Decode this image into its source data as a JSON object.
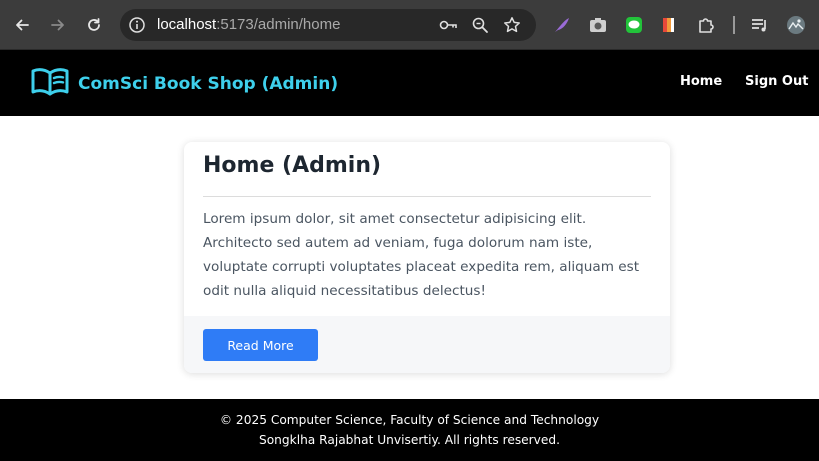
{
  "browser": {
    "url_host": "localhost",
    "url_path": ":5173/admin/home",
    "icons": [
      "back-arrow-icon",
      "forward-arrow-icon",
      "reload-icon",
      "site-info-icon",
      "password-key-icon",
      "zoom-icon",
      "bookmark-star-icon",
      "feather-extension-icon",
      "camera-extension-icon",
      "line-extension-icon",
      "flag-extension-icon",
      "puzzle-extensions-icon",
      "media-queue-icon",
      "profile-avatar-icon"
    ]
  },
  "header": {
    "brand": "ComSci Book Shop (Admin)",
    "nav": [
      {
        "label": "Home"
      },
      {
        "label": "Sign Out"
      }
    ]
  },
  "card": {
    "title": "Home (Admin)",
    "body": "Lorem ipsum dolor, sit amet consectetur adipisicing elit. Architecto sed autem ad veniam, fuga dolorum nam iste, voluptate corrupti voluptates placeat expedita rem, aliquam est odit nulla aliquid necessitatibus delectus!",
    "button": "Read More"
  },
  "footer": {
    "line1": "© 2025 Computer Science, Faculty of Science and Technology",
    "line2": "Songklha Rajabhat Unvisertiy. All rights reserved."
  },
  "colors": {
    "brand_accent": "#3ed0ec",
    "button": "#2f7cf6",
    "header_bg": "#000000"
  }
}
